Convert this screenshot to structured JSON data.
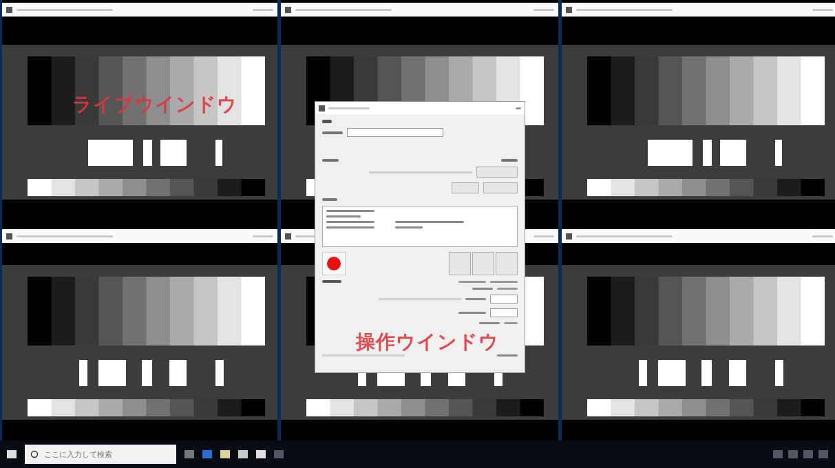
{
  "windows": [
    {
      "kind": "top"
    },
    {
      "kind": "top_covered"
    },
    {
      "kind": "top"
    },
    {
      "kind": "bottom"
    },
    {
      "kind": "bottom"
    },
    {
      "kind": "bottom"
    }
  ],
  "annotations": [
    {
      "text": "ライブウインドウ"
    },
    {
      "text": "操作ウインドウ"
    }
  ],
  "taskbar": {
    "search": {
      "placeholder": "ここに入力して検索"
    }
  }
}
